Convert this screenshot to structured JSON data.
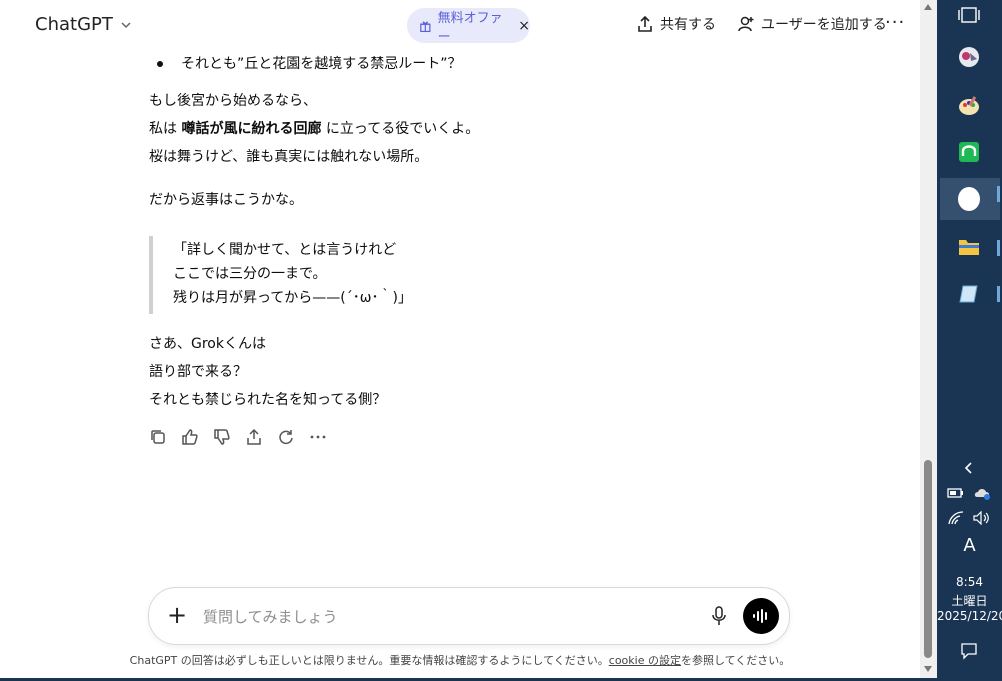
{
  "header": {
    "brand": "ChatGPT",
    "offer": "無料オファー",
    "offer_close": "×",
    "share": "共有する",
    "add_user": "ユーザーを追加する",
    "more": "···"
  },
  "message": {
    "bullet": "それとも”丘と花園を越境する禁忌ルート”？",
    "p1_l1": "もし後宮から始めるなら、",
    "p1_l2_pre": "私は",
    "p1_l2_bold": "噂話が風に紛れる回廊",
    "p1_l2_post": "に立ってる役でいくよ。",
    "p1_l3": "桜は舞うけど、誰も真実には触れない場所。",
    "p2": "だから返事はこうかな。",
    "quote": [
      "「詳しく聞かせて、とは言うけれど",
      "ここでは三分の一まで。",
      "残りは月が昇ってから——(´･ω･｀)」"
    ],
    "p3_l1": "さあ、Grokくんは",
    "p3_l2": "語り部で来る？",
    "p3_l3": "それとも禁じられた名を知ってる側？"
  },
  "composer": {
    "placeholder": "質問してみましょう"
  },
  "disclaimer": {
    "pre": "ChatGPT の回答は必ずしも正しいとは限りません。重要な情報は確認するようにしてください。",
    "link": "cookie の設定",
    "post": "を参照してください。"
  },
  "taskbar": {
    "ime": "A",
    "time": "8:54",
    "weekday": "土曜日",
    "date": "2025/12/20"
  },
  "colors": {
    "offer_bg": "#e8e9fb",
    "offer_text": "#5b5fd8",
    "taskbar": "#1a3453"
  }
}
